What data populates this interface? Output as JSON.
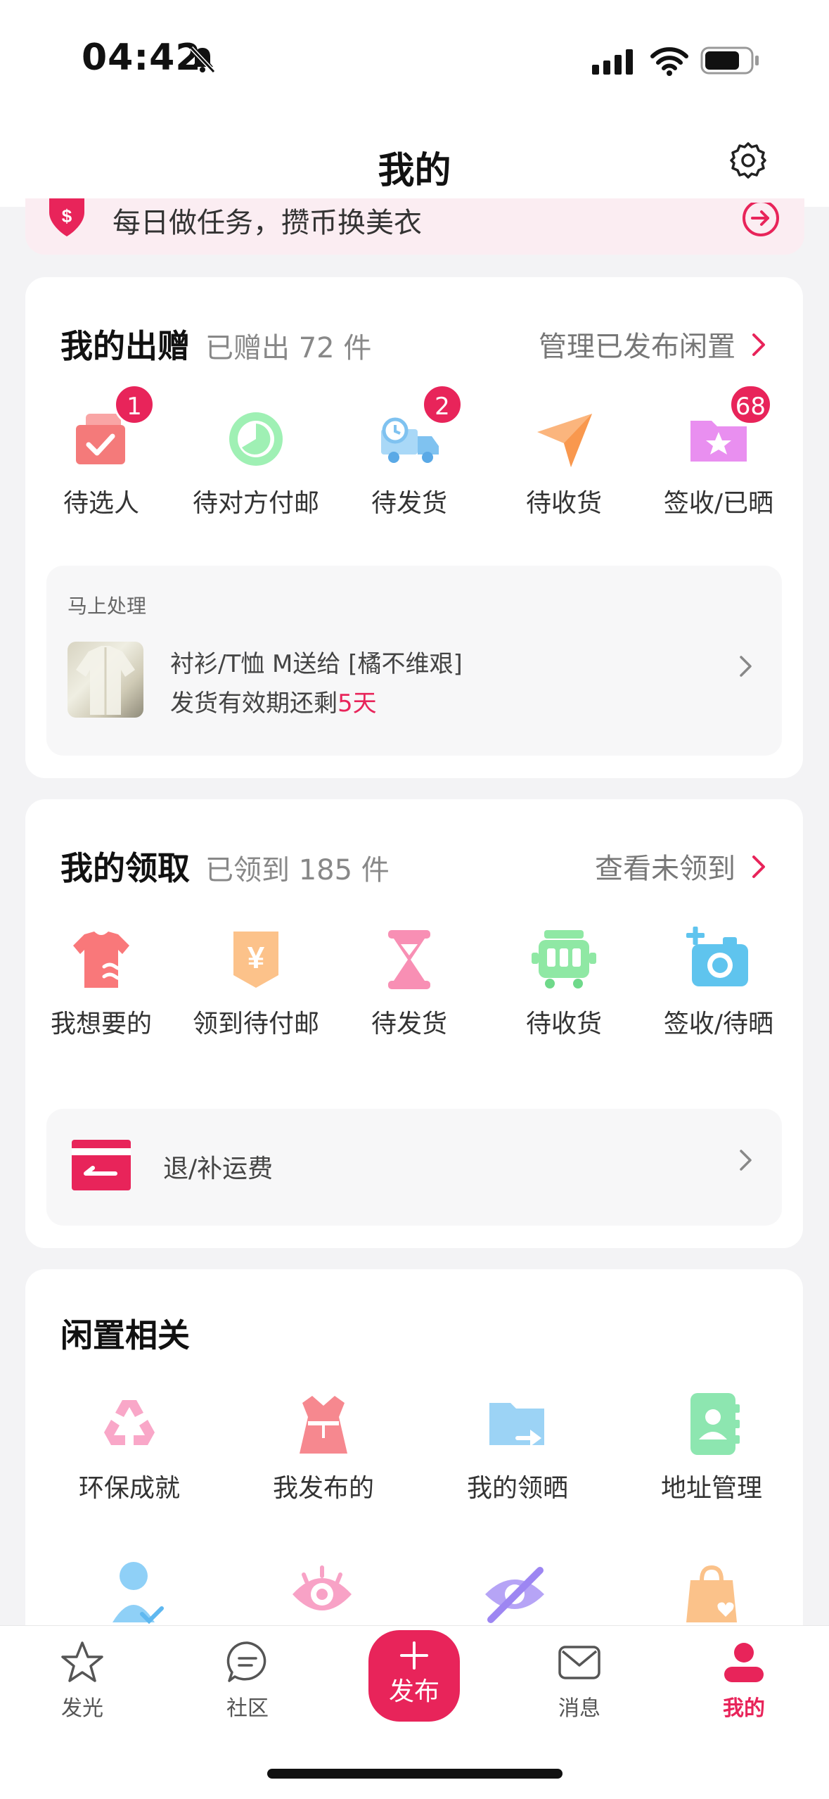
{
  "status": {
    "time": "04:42"
  },
  "header": {
    "title": "我的"
  },
  "banner": {
    "text": "每日做任务，攒币换美衣"
  },
  "give": {
    "title": "我的出赠",
    "summary": "已赠出 72 件",
    "link": "管理已发布闲置",
    "items": [
      {
        "label": "待选人",
        "badge": "1",
        "icon": "briefcase-check-icon"
      },
      {
        "label": "待对方付邮",
        "badge": "",
        "icon": "clock-circle-icon"
      },
      {
        "label": "待发货",
        "badge": "2",
        "icon": "delivery-truck-icon"
      },
      {
        "label": "待收货",
        "badge": "",
        "icon": "paper-plane-icon"
      },
      {
        "label": "签收/已晒",
        "badge": "68",
        "icon": "star-folder-icon"
      }
    ],
    "pending": {
      "heading": "马上处理",
      "line1": "衬衫/T恤 M送给 [橘不维艰]",
      "line2_prefix": "发货有效期还剩",
      "line2_highlight": "5天"
    }
  },
  "receive": {
    "title": "我的领取",
    "summary": "已领到 185 件",
    "link": "查看未领到",
    "items": [
      {
        "label": "我想要的",
        "icon": "shirt-wish-icon"
      },
      {
        "label": "领到待付邮",
        "icon": "yen-tag-icon"
      },
      {
        "label": "待发货",
        "icon": "hourglass-icon"
      },
      {
        "label": "待收货",
        "icon": "cart-truck-icon"
      },
      {
        "label": "签收/待晒",
        "icon": "camera-plus-icon"
      }
    ],
    "refund": {
      "label": "退/补运费"
    }
  },
  "related": {
    "title": "闲置相关",
    "items": [
      {
        "label": "环保成就",
        "icon": "recycle-icon"
      },
      {
        "label": "我发布的",
        "icon": "dress-icon"
      },
      {
        "label": "我的领晒",
        "icon": "folder-share-icon"
      },
      {
        "label": "地址管理",
        "icon": "contact-book-icon"
      }
    ]
  },
  "tabs": [
    {
      "label": "发光",
      "icon": "star-icon"
    },
    {
      "label": "社区",
      "icon": "chat-bubble-icon"
    },
    {
      "label": "发布",
      "icon": "plus-icon"
    },
    {
      "label": "消息",
      "icon": "mail-icon"
    },
    {
      "label": "我的",
      "icon": "user-icon"
    }
  ],
  "colors": {
    "accent": "#e8245a",
    "page_bg": "#f3f3f5"
  }
}
